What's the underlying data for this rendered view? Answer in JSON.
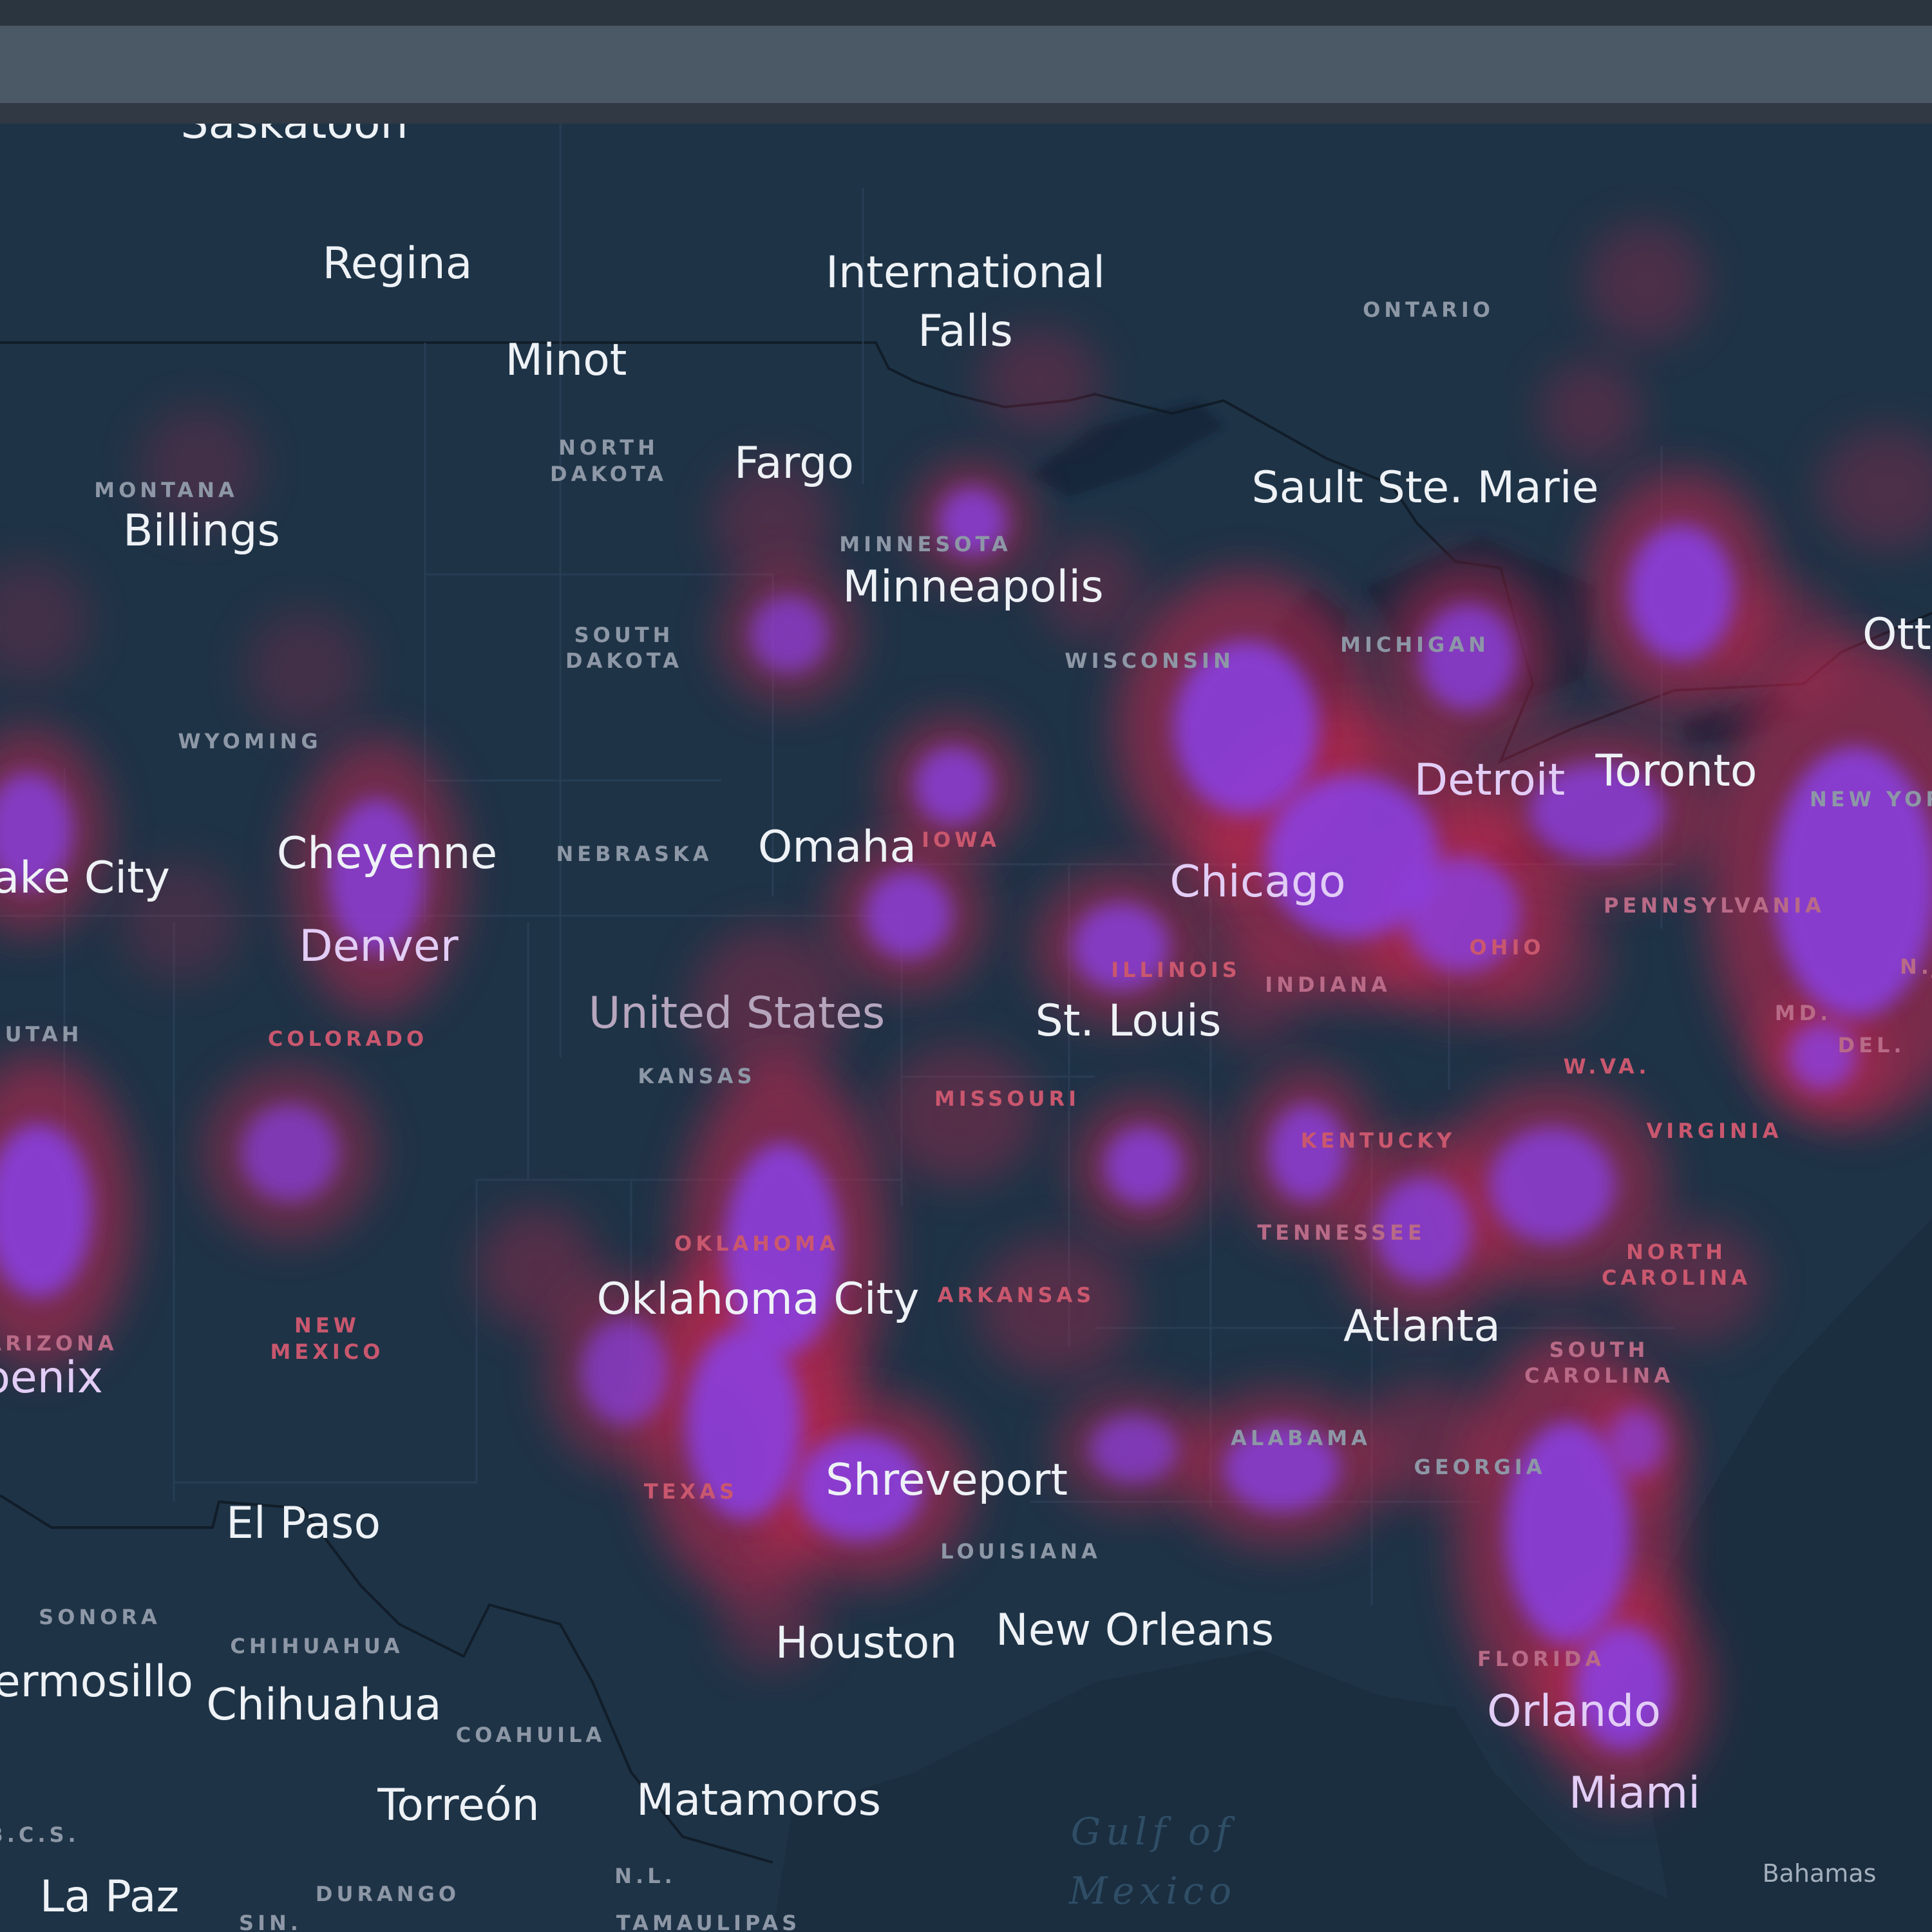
{
  "colors": {
    "land": "#1e3346",
    "border": "#101c26",
    "heat_outer": "#c4254f",
    "heat_inner": "#8a3fe6",
    "city_label": "#eef2f6",
    "state_label": "#8d97a6"
  },
  "cities": {
    "saskatoon": "Saskatoon",
    "regina": "Regina",
    "international_falls": "International",
    "international_falls_2": "Falls",
    "minot": "Minot",
    "fargo": "Fargo",
    "sault_ste_marie": "Sault Ste. Marie",
    "billings": "Billings",
    "minneapolis": "Minneapolis",
    "ottawa": "Ottawa",
    "toronto": "Toronto",
    "detroit": "Detroit",
    "cheyenne": "Cheyenne",
    "omaha": "Omaha",
    "salt_lake_city": "Salt Lake City",
    "chicago": "Chicago",
    "denver": "Denver",
    "united_states": "United States",
    "st_louis": "St. Louis",
    "oklahoma_city": "Oklahoma City",
    "atlanta": "Atlanta",
    "phoenix": "Phoenix",
    "shreveport": "Shreveport",
    "el_paso": "El Paso",
    "houston": "Houston",
    "new_orleans": "New Orleans",
    "hermosillo": "Hermosillo",
    "chihuahua": "Chihuahua",
    "orlando": "Orlando",
    "torreon": "Torreón",
    "matamoros": "Matamoros",
    "miami": "Miami",
    "la_paz": "La Paz",
    "bahamas": "Bahamas"
  },
  "regions": {
    "ontario": "ONTARIO",
    "north_dakota_1": "NORTH",
    "north_dakota_2": "DAKOTA",
    "montana": "MONTANA",
    "minnesota": "MINNESOTA",
    "michigan": "MICHIGAN",
    "south_dakota_1": "SOUTH",
    "south_dakota_2": "DAKOTA",
    "wisconsin": "WISCONSIN",
    "wyoming": "WYOMING",
    "new_york": "NEW YORK",
    "nebraska": "NEBRASKA",
    "iowa": "IOWA",
    "pennsylvania": "PENNSYLVANIA",
    "utah": "UTAH",
    "colorado": "COLORADO",
    "illinois": "ILLINOIS",
    "indiana": "INDIANA",
    "ohio": "OHIO",
    "nj": "N.J.",
    "kansas": "KANSAS",
    "missouri": "MISSOURI",
    "md": "MD.",
    "del": "DEL.",
    "wva": "W.VA.",
    "kentucky": "KENTUCKY",
    "virginia": "VIRGINIA",
    "tennessee": "TENNESSEE",
    "oklahoma": "OKLAHOMA",
    "north_carolina_1": "NORTH",
    "north_carolina_2": "CAROLINA",
    "arkansas": "ARKANSAS",
    "arizona": "ARIZONA",
    "new_mexico_1": "NEW",
    "new_mexico_2": "MEXICO",
    "south_carolina_1": "SOUTH",
    "south_carolina_2": "CAROLINA",
    "alabama": "ALABAMA",
    "georgia": "GEORGIA",
    "texas": "TEXAS",
    "louisiana": "LOUISIANA",
    "sonora": "SONORA",
    "chihuahua_state": "CHIHUAHUA",
    "florida": "FLORIDA",
    "coahuila": "COAHUILA",
    "bcs": "B.C.S.",
    "nl": "N.L.",
    "durango": "DURANGO",
    "sin": "SIN.",
    "tamaulipas": "TAMAULIPAS"
  },
  "water": {
    "gulf_1": "Gulf of",
    "gulf_2": "Mexico"
  }
}
